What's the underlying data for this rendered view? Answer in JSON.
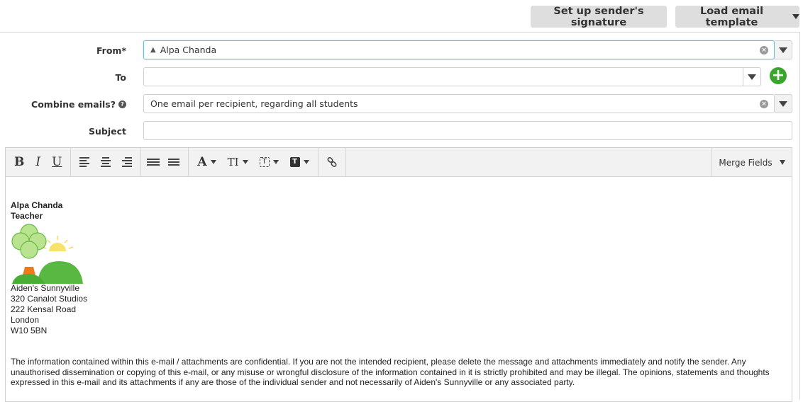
{
  "header": {
    "signature_button": "Set up sender's signature",
    "template_button": "Load email template"
  },
  "form": {
    "from_label": "From*",
    "from_value": "Alpa Chanda",
    "to_label": "To",
    "to_value": "",
    "combine_label": "Combine emails?",
    "combine_value": "One email per recipient, regarding all students",
    "subject_label": "Subject",
    "subject_value": ""
  },
  "toolbar": {
    "bold": "B",
    "italic": "I",
    "underline": "U",
    "font": "A",
    "text_size": "TI",
    "merge_fields": "Merge Fields"
  },
  "signature": {
    "name": "Alpa Chanda",
    "role": "Teacher",
    "address_lines": [
      "Aiden's Sunnyville",
      "320 Canalot Studios",
      "222 Kensal Road",
      "London",
      "W10 5BN"
    ],
    "disclaimer": "The information contained within this e-mail / attachments are confidential. If you are not the intended recipient, please delete the message and attachments immediately and notify the sender. Any unauthorised dissemination or copying of this e-mail, or any misuse or wrongful disclosure of the information contained in it is strictly prohibited and may be illegal. The opinions, statements and thoughts expressed in this e-mail and its attachments if any are those of the individual sender and not necessarily of Aiden's Sunnyville or any associated party."
  },
  "colors": {
    "accent_focus": "#5bc0de",
    "add_green": "#3aa52c",
    "button_grey": "#dedede"
  }
}
